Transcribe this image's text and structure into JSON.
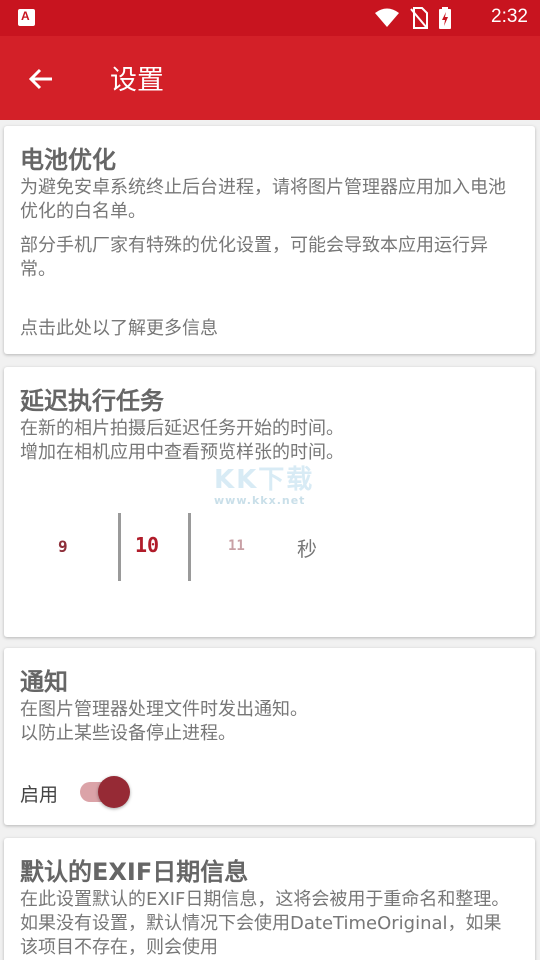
{
  "status_bar": {
    "time": "2:32",
    "icons": [
      "app-a-icon",
      "wifi-icon",
      "no-sim-icon",
      "battery-charging-icon"
    ]
  },
  "app_bar": {
    "title": "设置",
    "back_icon": "arrow-back-icon"
  },
  "battery": {
    "title": "电池优化",
    "desc1": "为避免安卓系统终止后台进程，请将图片管理器应用加入电池优化的白名单。",
    "desc2": "部分手机厂家有特殊的优化设置，可能会导致本应用运行异常。",
    "link": "点击此处以了解更多信息"
  },
  "delay": {
    "title": "延迟执行任务",
    "desc1": "在新的相片拍摄后延迟任务开始的时间。",
    "desc2": "增加在相机应用中查看预览样张的时间。",
    "picker": {
      "prev": "9",
      "selected": "10",
      "next": "11",
      "unit": "秒"
    },
    "watermark": {
      "main": "KK下载",
      "sub": "www.kkx.net"
    }
  },
  "notify": {
    "title": "通知",
    "desc1": "在图片管理器处理文件时发出通知。",
    "desc2": "以防止某些设备停止进程。",
    "toggle_label": "启用",
    "enabled": true
  },
  "exif": {
    "title": "默认的EXIF日期信息",
    "desc": "在此设置默认的EXIF日期信息，这将会被用于重命名和整理。如果没有设置，默认情况下会使用DateTimeOriginal，如果该项目不存在，则会使用"
  },
  "colors": {
    "status_bar": "#c8141f",
    "app_bar": "#d32028",
    "accent": "#962a35"
  }
}
